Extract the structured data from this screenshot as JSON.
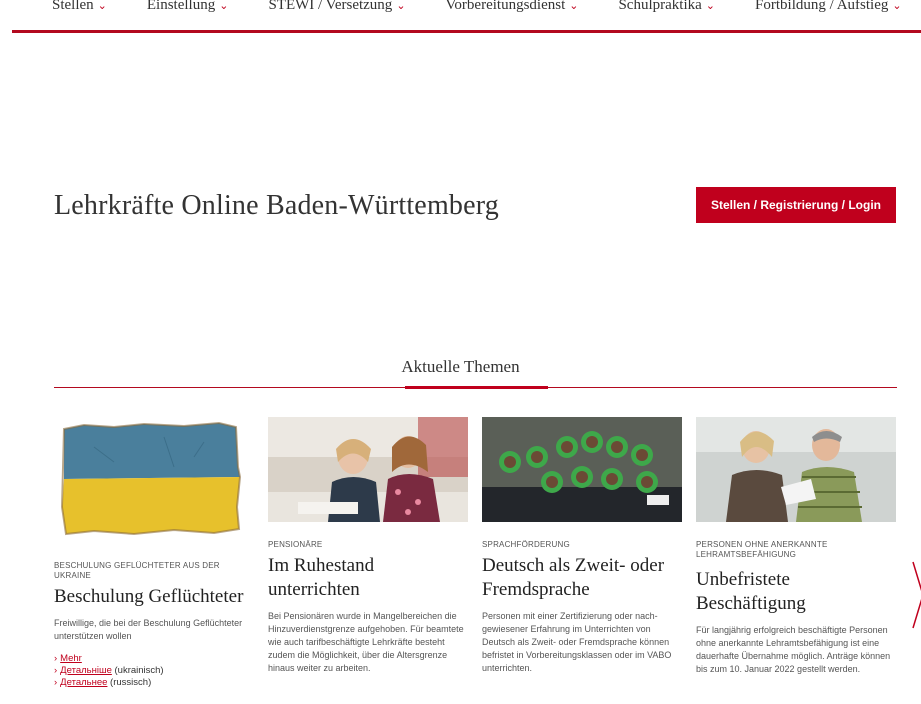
{
  "nav": [
    {
      "label": "Stellen"
    },
    {
      "label": "Einstellung"
    },
    {
      "label": "STEWI / Versetzung"
    },
    {
      "label": "Vorbereitungsdienst"
    },
    {
      "label": "Schulpraktika"
    },
    {
      "label": "Fortbildung / Aufstieg"
    }
  ],
  "header": {
    "title": "Lehrkräfte Online Baden-Württemberg",
    "cta": "Stellen / Registrierung / Login"
  },
  "topics": {
    "title": "Aktuelle Themen",
    "cards": [
      {
        "kicker": "BESCHULUNG GEFLÜCHTETER AUS DER UKRAINE",
        "title": "Beschulung Geflüchteter",
        "text": "Freiwillige, die bei der Beschulung Geflüchte­ter unterstützen wollen",
        "links": [
          {
            "link": "Mehr",
            "suffix": ""
          },
          {
            "link": "Детальніше",
            "suffix": " (ukrainisch)"
          },
          {
            "link": "Детальнее",
            "suffix": "  (russisch)"
          }
        ]
      },
      {
        "kicker": "PENSIONÄRE",
        "title": "Im Ruhestand unterrichten",
        "text": "Bei Pensionären wurde in Mangelbereichen die Hinzuverdienstgrenze aufgehoben. Für beamtete wie auch tarifbeschäftigte Lehr­kräfte besteht zudem die Möglichkeit, über die Altersgrenze hinaus weiter zu arbeiten."
      },
      {
        "kicker": "SPRACHFÖRDERUNG",
        "title": "Deutsch als Zweit- oder Fremdsprache",
        "text": "Personen mit einer Zertifizierung oder nach­gewiesener Erfahrung im Unterrichten von Deutsch als Zweit- oder Fremdsprache kön­nen befristet in Vorbereitungsklassen oder im VABO unterrichten."
      },
      {
        "kicker": "PERSONEN OHNE ANERKANNTE LEHRAMTSBEFÄHIGUNG",
        "title": "Unbefristete Beschäftigung",
        "text": "Für langjährig erfolgreich beschäftigte Perso­nen ohne anerkannte Lehramtsbefähigung ist eine dauerhafte Übernahme möglich. An­träge können bis zum 10. Januar 2022 ge­stellt werden."
      }
    ]
  },
  "colors": {
    "accent": "#c0001d",
    "text": "#333333"
  }
}
